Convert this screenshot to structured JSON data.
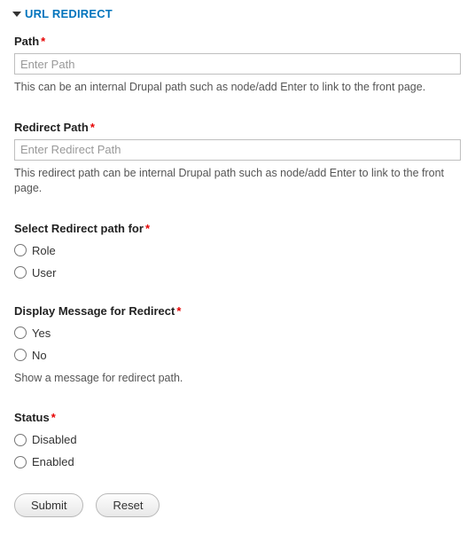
{
  "section": {
    "title": "URL REDIRECT"
  },
  "path": {
    "label": "Path",
    "placeholder": "Enter Path",
    "value": "",
    "desc": "This can be an internal Drupal path such as node/add Enter to link to the front page."
  },
  "redirect_path": {
    "label": "Redirect Path",
    "placeholder": "Enter Redirect Path",
    "value": "",
    "desc": "This redirect path can be internal Drupal path such as node/add Enter to link to the front page."
  },
  "select_for": {
    "label": "Select Redirect path for",
    "options": {
      "role": "Role",
      "user": "User"
    }
  },
  "display_msg": {
    "label": "Display Message for Redirect",
    "options": {
      "yes": "Yes",
      "no": "No"
    },
    "desc": "Show a message for redirect path."
  },
  "status": {
    "label": "Status",
    "options": {
      "disabled": "Disabled",
      "enabled": "Enabled"
    }
  },
  "buttons": {
    "submit": "Submit",
    "reset": "Reset"
  },
  "required_marker": "*"
}
